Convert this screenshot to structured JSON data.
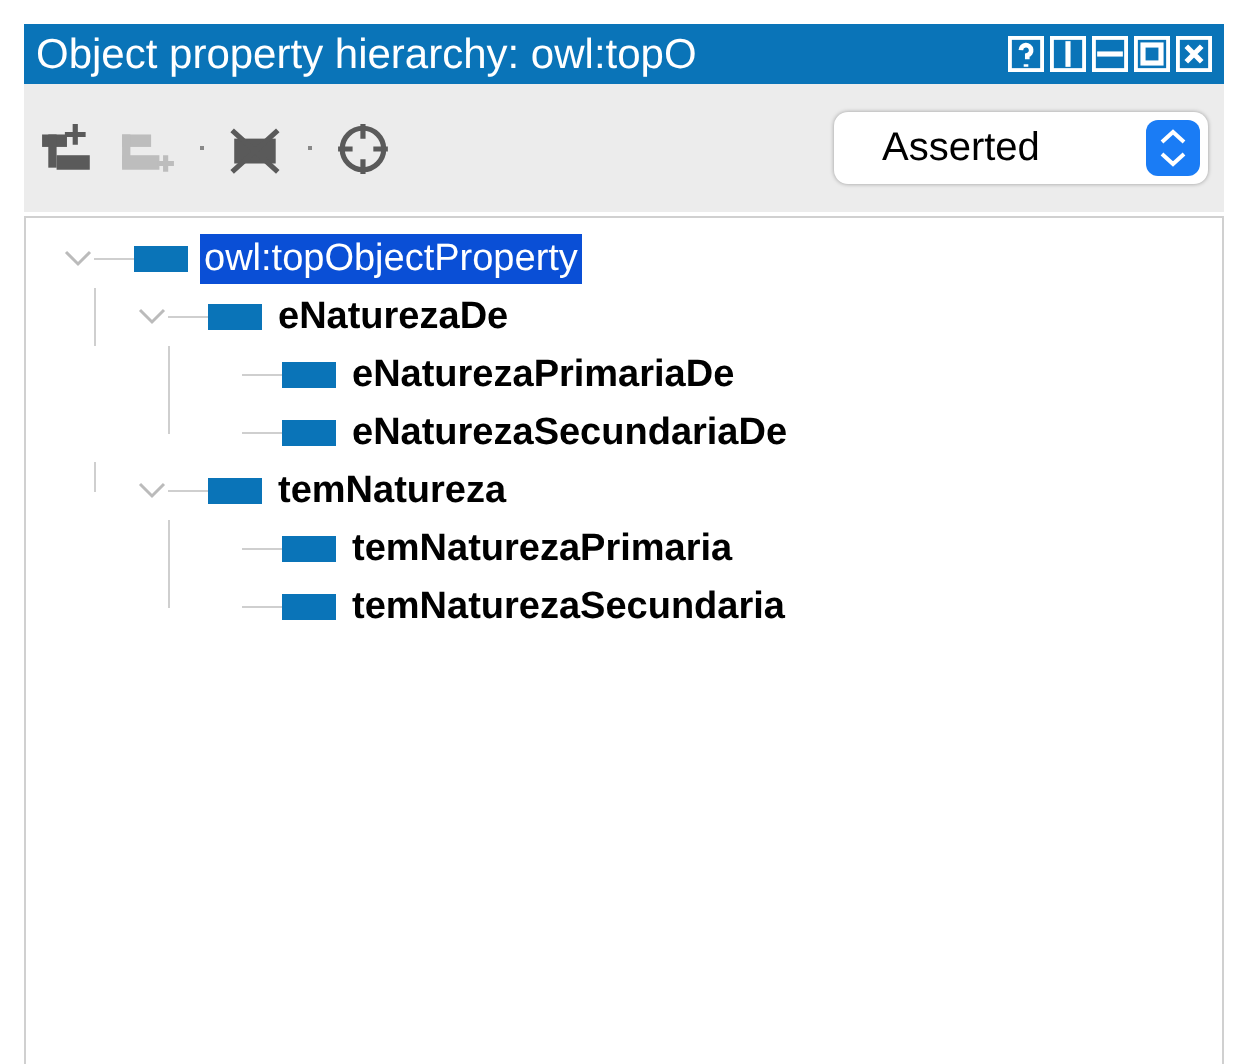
{
  "window": {
    "title": "Object property hierarchy: owl:topO"
  },
  "title_buttons": [
    {
      "kind": "help"
    },
    {
      "kind": "split-vertical"
    },
    {
      "kind": "split-horizontal"
    },
    {
      "kind": "maximize"
    },
    {
      "kind": "close"
    }
  ],
  "toolbar": [
    {
      "kind": "add-sub",
      "disabled": false
    },
    {
      "kind": "add-sibling",
      "disabled": true
    },
    {
      "kind": "delete",
      "disabled": false
    },
    {
      "kind": "target",
      "disabled": false
    }
  ],
  "view_select": {
    "value": "Asserted"
  },
  "tree": [
    {
      "label": "owl:topObjectProperty",
      "selected": true,
      "expanded": true,
      "children": [
        {
          "label": "eNaturezaDe",
          "selected": false,
          "expanded": true,
          "children": [
            {
              "label": "eNaturezaPrimariaDe",
              "selected": false
            },
            {
              "label": "eNaturezaSecundariaDe",
              "selected": false
            }
          ]
        },
        {
          "label": "temNatureza",
          "selected": false,
          "expanded": true,
          "children": [
            {
              "label": "temNaturezaPrimaria",
              "selected": false
            },
            {
              "label": "temNaturezaSecundaria",
              "selected": false
            }
          ]
        }
      ]
    }
  ]
}
